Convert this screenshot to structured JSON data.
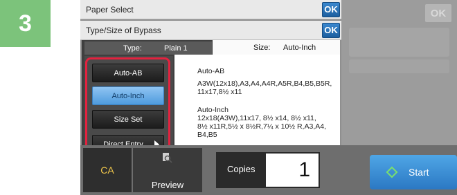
{
  "step": {
    "number": "3"
  },
  "header": {
    "paper_select": "Paper Select",
    "type_size": "Type/Size of Bypass",
    "ok": "OK",
    "bg_ok": "OK"
  },
  "tabs": {
    "type_label": "Type:",
    "type_value": "Plain 1",
    "size_label": "Size:",
    "size_value": "Auto-Inch"
  },
  "options": [
    {
      "label": "Auto-AB"
    },
    {
      "label": "Auto-Inch"
    },
    {
      "label": "Size Set"
    },
    {
      "label": "Direct Entry"
    }
  ],
  "content": {
    "auto_ab_title": "Auto-AB",
    "auto_ab_line1": "A3W(12x18),A3,A4,A4R,A5R,B4,B5,B5R,",
    "auto_ab_line2": "11x17,8½ x11",
    "auto_inch_title": "Auto-Inch",
    "auto_inch_line1": "12x18(A3W),11x17, 8½ x14, 8½ x11,",
    "auto_inch_line2": "8½ x11R,5½ x 8½R,7¼ x 10½ R,A3,A4,",
    "auto_inch_line3": "B4,B5"
  },
  "bottom": {
    "ca": "CA",
    "preview": "Preview",
    "copies_label": "Copies",
    "copies_value": "1",
    "start": "Start"
  },
  "colors": {
    "step_badge": "#7cc37b",
    "highlight": "#e3223f",
    "selected": "#5ea8e6",
    "start": "#3a8fd6"
  }
}
